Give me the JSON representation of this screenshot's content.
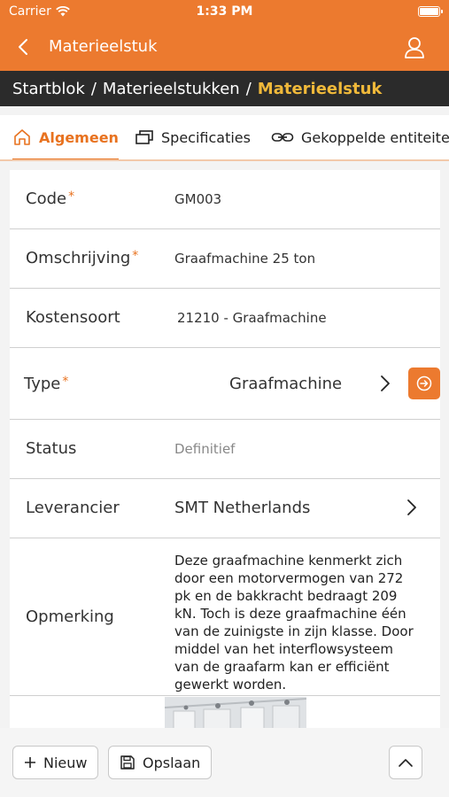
{
  "status_bar": {
    "carrier": "Carrier",
    "time": "1:33 PM"
  },
  "nav": {
    "title": "Materieelstuk"
  },
  "breadcrumb": {
    "items": [
      "Startblok",
      "Materieelstukken"
    ],
    "separator": "/",
    "current": "Materieelstuk"
  },
  "tabs": [
    {
      "label": "Algemeen",
      "icon": "home-icon",
      "active": true
    },
    {
      "label": "Specificaties",
      "icon": "windows-icon",
      "active": false
    },
    {
      "label": "Gekoppelde entiteiten",
      "icon": "link-icon",
      "active": false
    }
  ],
  "form": {
    "code": {
      "label": "Code",
      "required_mark": "*",
      "value": "GM003"
    },
    "omschrijving": {
      "label": "Omschrijving",
      "required_mark": "*",
      "value": "Graafmachine 25 ton"
    },
    "kostensoort": {
      "label": "Kostensoort",
      "value": "21210 - Graafmachine"
    },
    "type": {
      "label": "Type",
      "required_mark": "*",
      "value": "Graafmachine"
    },
    "status": {
      "label": "Status",
      "value": "Definitief"
    },
    "leverancier": {
      "label": "Leverancier",
      "value": "SMT Netherlands"
    },
    "opmerking": {
      "label": "Opmerking",
      "lines": [
        "Deze graafmachine kenmerkt zich",
        "door een motorvermogen van 272",
        "pk en de bakkracht bedraagt 209",
        "kN. Toch is deze graafmachine één",
        "van de zuinigste in zijn klasse. Door",
        "middel van het interflowsysteem",
        "van de graafarm kan er efficiënt",
        "gewerkt worden."
      ]
    }
  },
  "actions": {
    "new_label": "Nieuw",
    "save_label": "Opslaan"
  },
  "colors": {
    "primary": "#ec7a2f",
    "accent_text": "#e8721f",
    "breadcrumb_bg": "#2b2b2b",
    "breadcrumb_current": "#f0b93a"
  }
}
